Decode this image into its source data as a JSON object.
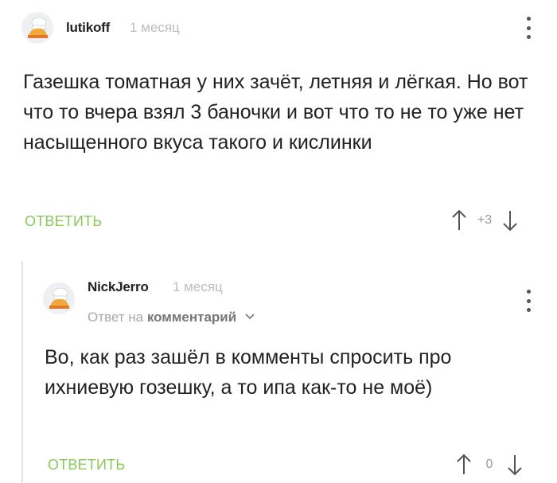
{
  "comments": [
    {
      "author": "lutikoff",
      "time": "1 месяц",
      "text": "Газешка томатная у них зачёт, летняя и лёгкая. Но вот что то вчера взял 3 баночки и вот что то не то уже нет насыщенного вкуса такого и кислинки",
      "reply_label": "ОТВЕТИТЬ",
      "score": "+3"
    },
    {
      "author": "NickJerro",
      "time": "1 месяц",
      "reply_prefix": "Ответ на",
      "reply_link": "комментарий",
      "text": "Во, как раз зашёл в комменты спросить про ихниевую гозешку, а то ипа как-то не моё)",
      "reply_label": "ОТВЕТИТЬ",
      "score": "0"
    }
  ],
  "colors": {
    "accent": "#8ac858",
    "muted": "#bdbdbd",
    "text": "#222222"
  },
  "icons": [
    "avatar-icon",
    "more-icon",
    "upvote-icon",
    "downvote-icon",
    "chevron-down-icon"
  ]
}
